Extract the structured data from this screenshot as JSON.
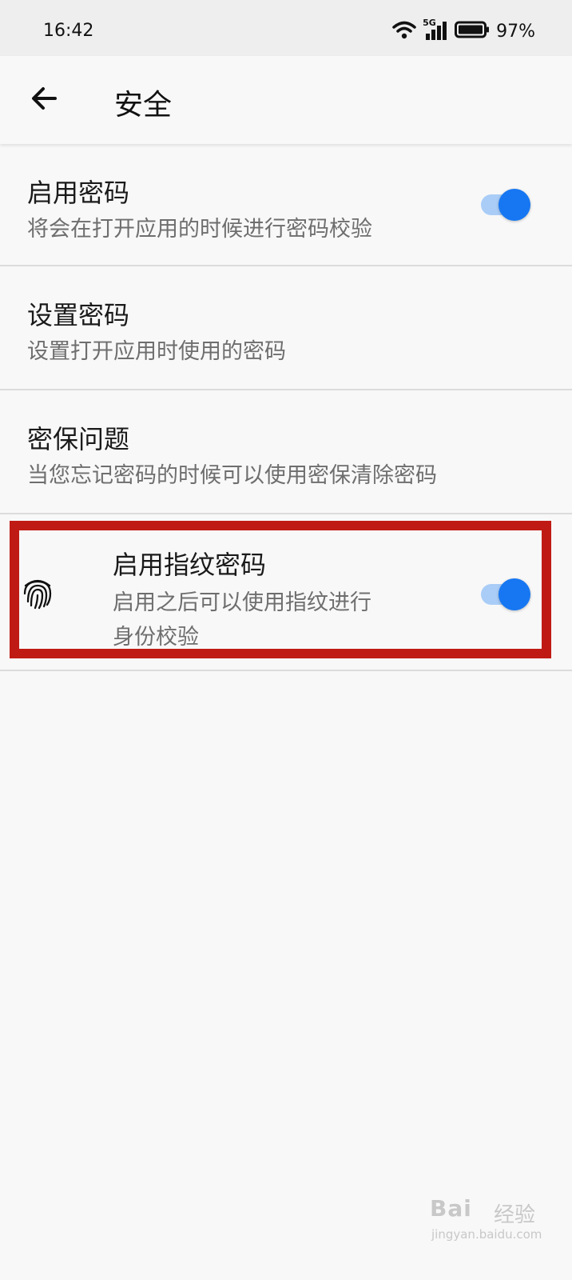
{
  "status_bar": {
    "time": "16:42",
    "network": "5G",
    "battery": "97%"
  },
  "app_bar": {
    "title": "安全",
    "back_icon": "arrow-left-icon"
  },
  "settings": [
    {
      "title": "启用密码",
      "subtitle": "将会在打开应用的时候进行密码校验",
      "toggle": true
    },
    {
      "title": "设置密码",
      "subtitle": "设置打开应用时使用的密码"
    },
    {
      "title": "密保问题",
      "subtitle": "当您忘记密码的时候可以使用密保清除密码"
    },
    {
      "title": "启用指纹密码",
      "subtitle_line1": "启用之后可以使用指纹进行",
      "subtitle_line2": "身份校验",
      "icon": "fingerprint-icon",
      "toggle": true
    }
  ],
  "colors": {
    "accent": "#1777f2",
    "highlight": "#bf1b14"
  },
  "watermark": {
    "logo": "Bai",
    "brand_cn": "经验",
    "url": "jingyan.baidu.com"
  }
}
